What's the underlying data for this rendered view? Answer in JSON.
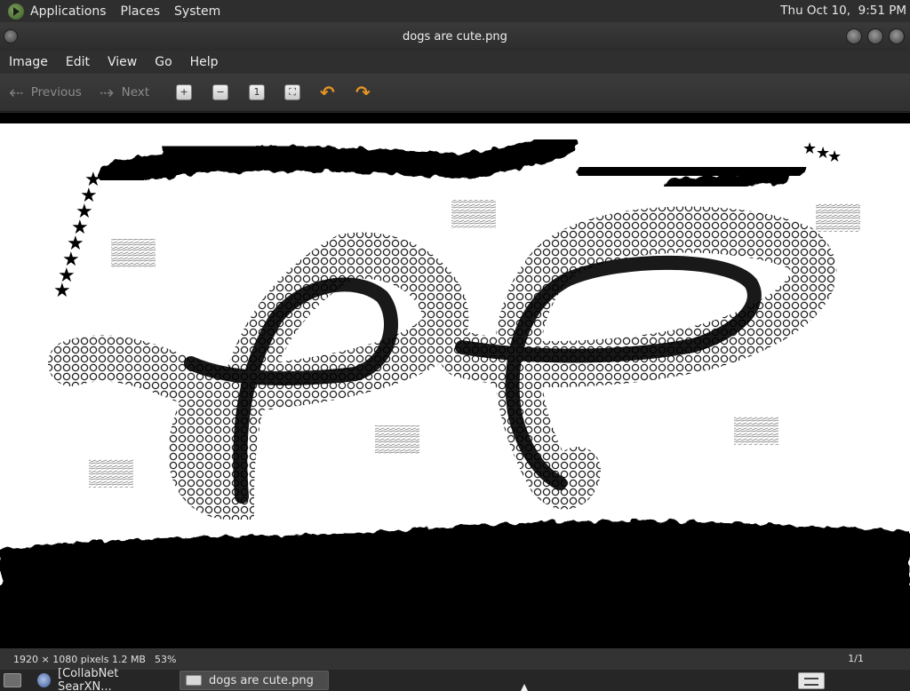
{
  "top_panel": {
    "menus": [
      "Applications",
      "Places",
      "System"
    ],
    "clock": "Thu Oct 10,  9:51 PM"
  },
  "window": {
    "title": "dogs are cute.png"
  },
  "menubar": {
    "items": [
      "Image",
      "Edit",
      "View",
      "Go",
      "Help"
    ]
  },
  "toolbar": {
    "previous_label": "Previous",
    "next_label": "Next",
    "icons": [
      "zoom-in-icon",
      "zoom-out-icon",
      "zoom-normal-icon",
      "zoom-fit-icon",
      "rotate-left-icon",
      "rotate-right-icon"
    ]
  },
  "image": {
    "description": "Black and white painting with two loops and strokes"
  },
  "statusbar": {
    "info": "1920 × 1080 pixels  1.2 MB",
    "zoom": "53%",
    "page": "1/1"
  },
  "taskbar": {
    "tasks": [
      {
        "label": "[CollabNet SearXN..."
      },
      {
        "label": "dogs are cute.png"
      }
    ]
  },
  "colors": {
    "panel_bg": "#2e2e2e",
    "accent_rotate": "#e59521"
  }
}
